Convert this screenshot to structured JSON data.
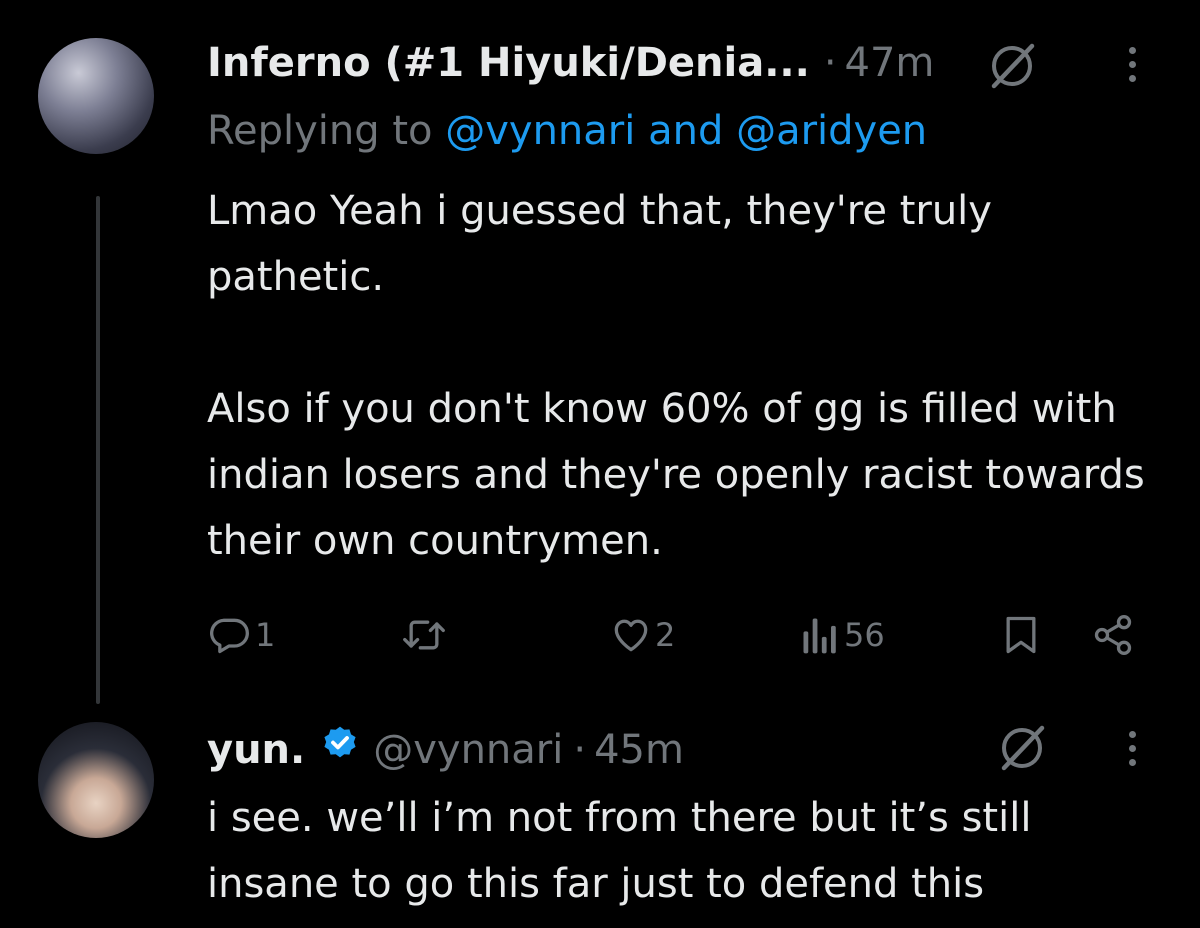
{
  "tweet1": {
    "display_name": "Inferno (#1 Hiyuki/Denia...",
    "separator": "·",
    "time": "47m",
    "replying_label": "Replying to",
    "replying_user1": "@vynnari",
    "replying_and": "and",
    "replying_user2": "@aridyen",
    "paragraph1": "Lmao Yeah i guessed that, they're truly pathetic.",
    "paragraph2": "Also if you don't know 60% of gg is filled with indian losers and they're openly racist towards their own countrymen.",
    "reply_count": "1",
    "retweet_count": "",
    "like_count": "2",
    "view_count": "56"
  },
  "tweet2": {
    "display_name": "yun.",
    "handle": "@vynnari",
    "separator": "·",
    "time": "45m",
    "text": "i see. we’ll i’m not from there but it’s still insane to go this far just to defend this"
  },
  "icons": {
    "reply": "reply-icon",
    "retweet": "retweet-icon",
    "like": "heart-icon",
    "views": "views-icon",
    "bookmark": "bookmark-icon",
    "share": "share-icon",
    "grok": "grok-icon",
    "more": "more-icon",
    "verified": "verified-badge-icon"
  },
  "colors": {
    "background": "#000000",
    "text": "#e7e9ea",
    "muted": "#71767b",
    "link": "#1d9bf0",
    "thread_line": "#333639"
  }
}
